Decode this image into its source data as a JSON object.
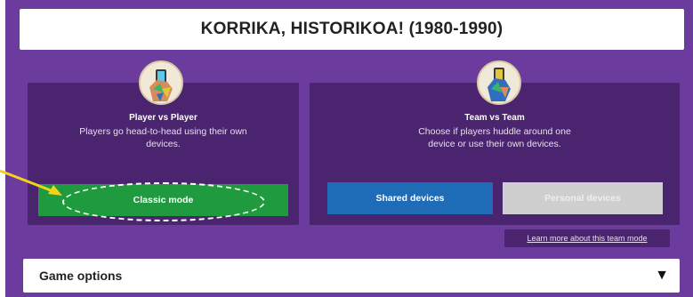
{
  "header": {
    "title": "KORRIKA, HISTORIKOA! (1980-1990)"
  },
  "player_vs_player": {
    "heading": "Player vs Player",
    "description": "Players go head-to-head using their own devices.",
    "button_label": "Classic mode",
    "icon": "hand-holding-phone-icon"
  },
  "team_vs_team": {
    "heading": "Team vs Team",
    "description": "Choose if players huddle around one device or use their own devices.",
    "shared_label": "Shared devices",
    "personal_label": "Personal devices",
    "learn_more": "Learn more about this team mode",
    "icon": "hand-holding-phone-icon"
  },
  "options": {
    "label": "Game options",
    "chevron": "▼"
  },
  "colors": {
    "background": "#6b3b9e",
    "panel": "#4b2470",
    "classic": "#1f9a3e",
    "shared": "#1e6bb8",
    "personal": "#cfcfcf",
    "annotation_arrow": "#f2d21b"
  }
}
